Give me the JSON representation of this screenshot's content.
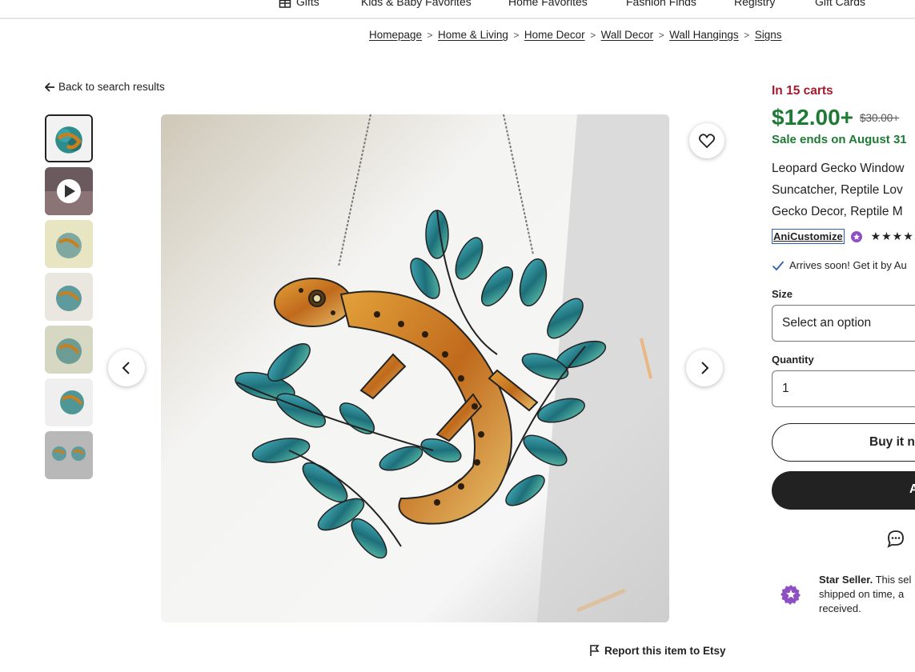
{
  "nav": {
    "items": [
      {
        "label": "Gifts",
        "icon": "gift-icon"
      },
      {
        "label": "Kids & Baby Favorites"
      },
      {
        "label": "Home Favorites"
      },
      {
        "label": "Fashion Finds"
      },
      {
        "label": "Registry"
      },
      {
        "label": "Gift Cards"
      }
    ]
  },
  "breadcrumb": [
    "Homepage",
    "Home & Living",
    "Home Decor",
    "Wall Decor",
    "Wall Hangings",
    "Signs"
  ],
  "back_link": "Back to search results",
  "thumbnails": {
    "count": 7,
    "selected_index": 0,
    "video_index": 1
  },
  "gallery": {
    "favorite_icon": "heart-icon",
    "prev_icon": "chevron-left-icon",
    "next_icon": "chevron-right-icon"
  },
  "report_link": "Report this item to Etsy",
  "listing": {
    "in_carts": "In 15 carts",
    "price": "$12.00+",
    "original_price": "$30.00+",
    "sale_ends": "Sale ends on August 31",
    "title_lines": [
      "Leopard Gecko Window",
      "Suncatcher, Reptile Lov",
      "Gecko Decor, Reptile M"
    ],
    "shop_name": "AniCustomize",
    "rating_stars": "★★★★★",
    "arrives": "Arrives soon! Get it by Au",
    "size_label": "Size",
    "size_value": "Select an option",
    "quantity_label": "Quantity",
    "quantity_value": "1",
    "buy_now": "Buy it n",
    "add_to_cart": "A",
    "star_seller_title": "Star Seller.",
    "star_seller_text_1": " This sel",
    "star_seller_text_2": "shipped on time, a",
    "star_seller_text_3": "received."
  },
  "colors": {
    "price_green": "#1e7a35",
    "carts_red": "#a61a2e",
    "star_seller_purple": "#8e4fc4",
    "checkmark_blue": "#2f5fb3"
  }
}
